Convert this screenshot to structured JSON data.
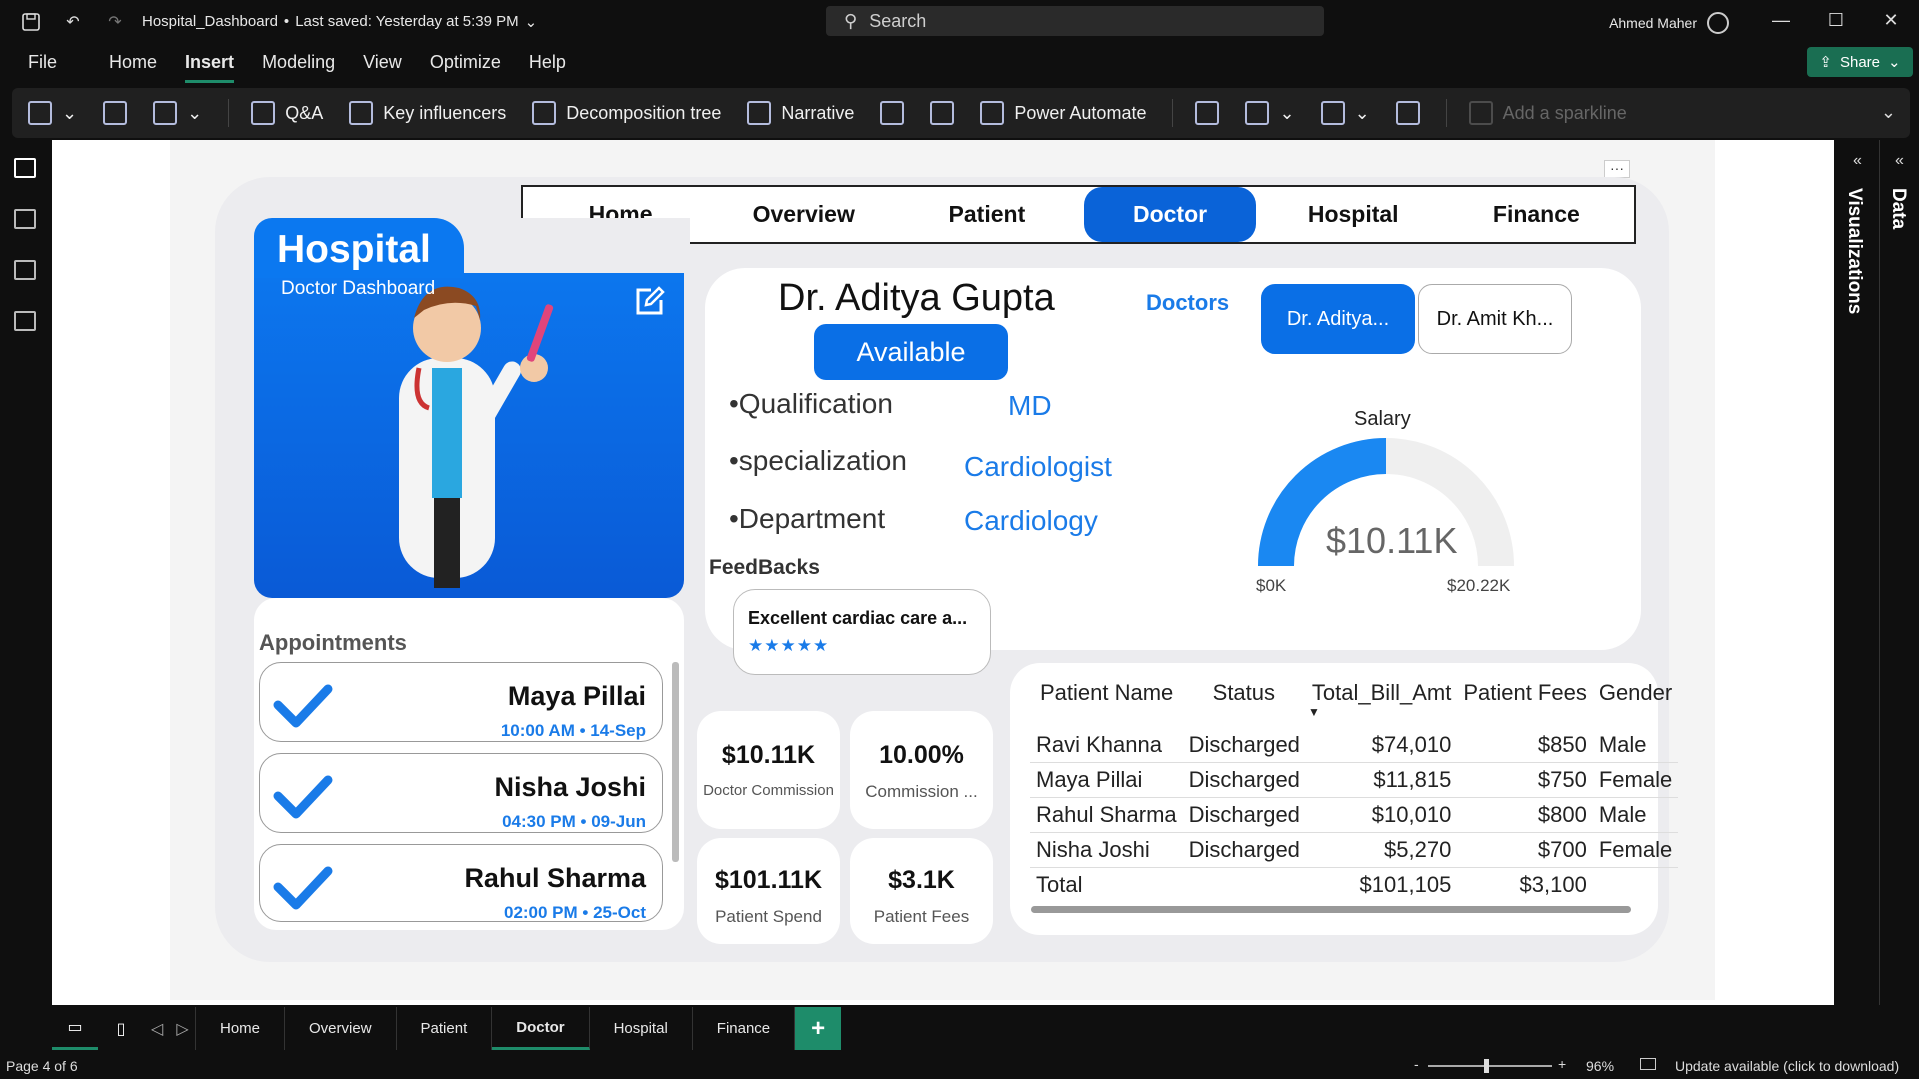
{
  "title_bar": {
    "file_name": "Hospital_Dashboard",
    "saved": "Last saved: Yesterday at 5:39 PM",
    "search_placeholder": "Search",
    "user": "Ahmed Maher"
  },
  "menu": [
    "File",
    "Home",
    "Insert",
    "Modeling",
    "View",
    "Optimize",
    "Help"
  ],
  "share_label": "Share",
  "ribbon": [
    "Q&A",
    "Key influencers",
    "Decomposition tree",
    "Narrative",
    "Power Automate",
    "Add a sparkline"
  ],
  "right_panes": [
    "Visualizations",
    "Data"
  ],
  "nav_tabs": [
    "Home",
    "Overview",
    "Patient",
    "Doctor",
    "Hospital",
    "Finance"
  ],
  "hero": {
    "title": "Hospital",
    "subtitle": "Doctor Dashboard"
  },
  "doctor": {
    "name": "Dr. Aditya Gupta",
    "status": "Available",
    "doctors_label": "Doctors",
    "chips": [
      "Dr. Aditya...",
      "Dr. Amit Kh..."
    ]
  },
  "info": [
    {
      "label": "•Qualification",
      "value": "MD"
    },
    {
      "label": "•specialization",
      "value": "Cardiologist"
    },
    {
      "label": "•Department",
      "value": "Cardiology"
    }
  ],
  "salary": {
    "title": "Salary",
    "value": "$10.11K",
    "min": "$0K",
    "max": "$20.22K",
    "fraction": 0.5
  },
  "feedback": {
    "title": "FeedBacks",
    "text": "Excellent cardiac care a...",
    "stars": "★★★★★"
  },
  "kpis": [
    {
      "value": "$10.11K",
      "label": "Doctor Commission"
    },
    {
      "value": "10.00%",
      "label": "Commission ..."
    },
    {
      "value": "$101.11K",
      "label": "Patient Spend"
    },
    {
      "value": "$3.1K",
      "label": "Patient Fees"
    }
  ],
  "appointments": {
    "title": "Appointments",
    "items": [
      {
        "name": "Maya Pillai",
        "time": "10:00 AM • 14-Sep"
      },
      {
        "name": "Nisha Joshi",
        "time": "04:30 PM • 09-Jun"
      },
      {
        "name": "Rahul Sharma",
        "time": "02:00 PM • 25-Oct"
      }
    ]
  },
  "patient_table": {
    "headers": [
      "Patient Name",
      "Status",
      "Total_Bill_Amt",
      "Patient Fees",
      "Gender"
    ],
    "rows": [
      [
        "Ravi Khanna",
        "Discharged",
        "$74,010",
        "$850",
        "Male"
      ],
      [
        "Maya Pillai",
        "Discharged",
        "$11,815",
        "$750",
        "Female"
      ],
      [
        "Rahul Sharma",
        "Discharged",
        "$10,010",
        "$800",
        "Male"
      ],
      [
        "Nisha Joshi",
        "Discharged",
        "$5,270",
        "$700",
        "Female"
      ]
    ],
    "total": [
      "Total",
      "",
      "$101,105",
      "$3,100",
      ""
    ]
  },
  "page_tabs": [
    "Home",
    "Overview",
    "Patient",
    "Doctor",
    "Hospital",
    "Finance"
  ],
  "status_bar": {
    "page": "Page 4 of 6",
    "zoom": "96%",
    "update": "Update available (click to download)"
  },
  "colors": {
    "accent": "#0a63d8",
    "brand_green": "#1e8c6a",
    "link_blue": "#1a7be8"
  }
}
